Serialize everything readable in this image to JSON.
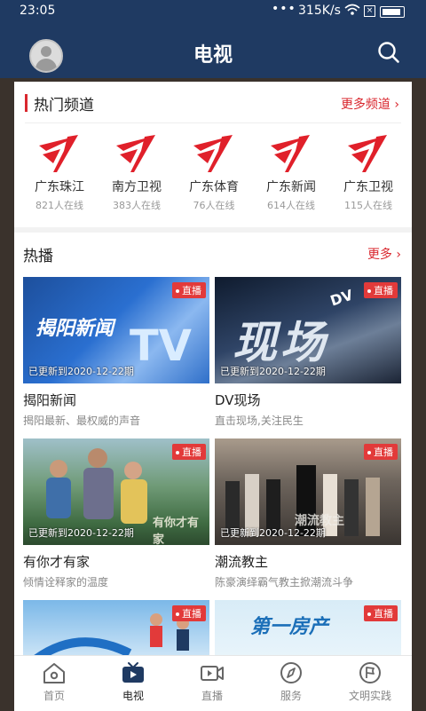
{
  "status_bar": {
    "time": "23:05",
    "network_speed": "315K/s",
    "dots": "•••",
    "icons": [
      "wifi-icon",
      "sim-icon",
      "battery-icon"
    ]
  },
  "header": {
    "title": "电视",
    "avatar_icon": "avatar",
    "search_icon": "search-icon"
  },
  "hot_channels": {
    "title": "热门频道",
    "more_label": "更多频道 ›",
    "items": [
      {
        "name": "广东珠江",
        "viewers": "821人在线",
        "icon": "guangdong-tv-logo"
      },
      {
        "name": "南方卫视",
        "viewers": "383人在线",
        "icon": "guangdong-tv-logo"
      },
      {
        "name": "广东体育",
        "viewers": "76人在线",
        "icon": "guangdong-tv-logo"
      },
      {
        "name": "广东新闻",
        "viewers": "614人在线",
        "icon": "guangdong-tv-logo"
      },
      {
        "name": "广东卫视",
        "viewers": "115人在线",
        "icon": "guangdong-tv-logo"
      }
    ]
  },
  "live": {
    "title": "热播",
    "more_label": "更多 ›",
    "badge": "直播",
    "cards": [
      {
        "title": "揭阳新闻",
        "subtitle": "揭阳最新、最权威的声音",
        "updated": "已更新到2020-12-22期",
        "thumb_text": "揭阳新闻",
        "thumb_text2": "TV"
      },
      {
        "title": "DV现场",
        "subtitle": "直击现场,关注民生",
        "updated": "已更新到2020-12-22期",
        "thumb_text": "现场",
        "thumb_text2": "DV"
      },
      {
        "title": "有你才有家",
        "subtitle": "倾情诠释家的温度",
        "updated": "已更新到2020-12-22期",
        "thumb_text": "有你才有家",
        "thumb_text2": ""
      },
      {
        "title": "潮流教主",
        "subtitle": "陈豪演绎霸气教主掀潮流斗争",
        "updated": "已更新到2020-12-22期",
        "thumb_text": "潮流教主",
        "thumb_text2": ""
      },
      {
        "title": "",
        "subtitle": "",
        "updated": "",
        "thumb_text": "",
        "thumb_text2": ""
      },
      {
        "title": "",
        "subtitle": "",
        "updated": "",
        "thumb_text": "第一房产",
        "thumb_text2": ""
      }
    ]
  },
  "tab_bar": {
    "tabs": [
      {
        "label": "首页",
        "icon": "home-icon"
      },
      {
        "label": "电视",
        "icon": "tv-icon"
      },
      {
        "label": "直播",
        "icon": "video-camera-icon"
      },
      {
        "label": "服务",
        "icon": "compass-icon"
      },
      {
        "label": "文明实践",
        "icon": "flag-icon"
      }
    ],
    "active": "电视"
  },
  "colors": {
    "header": "#1f3a62",
    "accent": "#d9272e",
    "background": "#f2f2f2"
  }
}
